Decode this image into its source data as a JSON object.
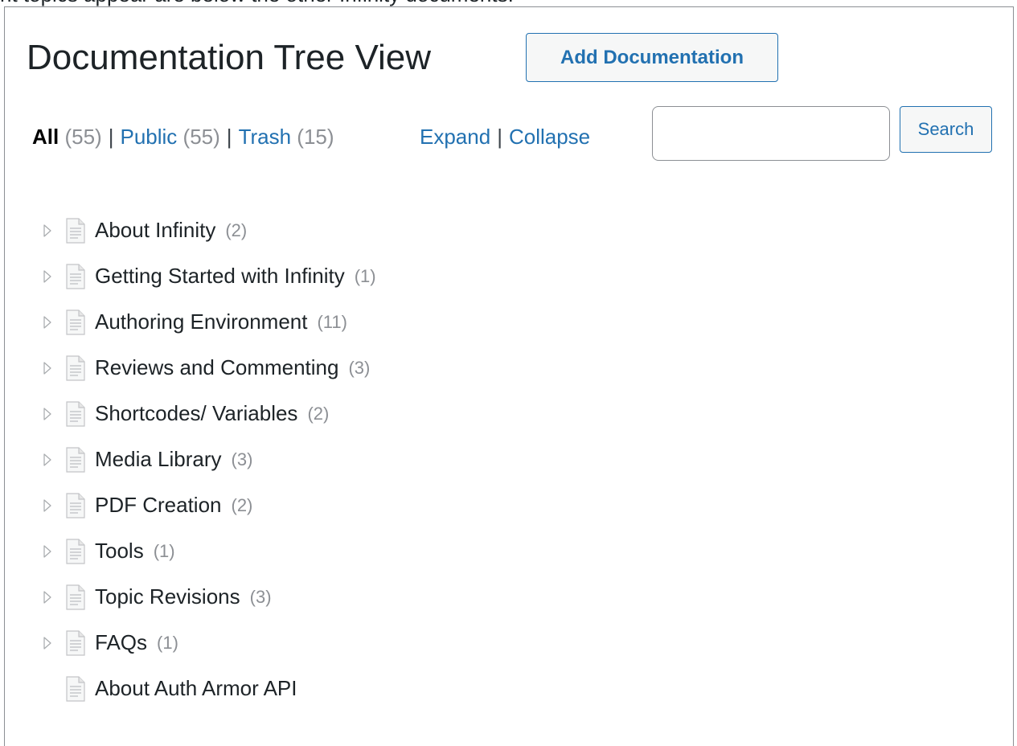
{
  "top_snippet": "nt topics appear are below the other Infinity documents.",
  "header": {
    "title": "Documentation Tree View",
    "add_button_label": "Add Documentation"
  },
  "filters": {
    "all": {
      "label": "All",
      "count": "(55)"
    },
    "public": {
      "label": "Public",
      "count": "(55)"
    },
    "trash": {
      "label": "Trash",
      "count": "(15)"
    },
    "separator": "|"
  },
  "tree_actions": {
    "expand": "Expand",
    "collapse": "Collapse",
    "separator": "|"
  },
  "search": {
    "value": "",
    "button_label": "Search"
  },
  "tree": {
    "items": [
      {
        "title": "About Infinity",
        "count": "(2)",
        "has_children": true
      },
      {
        "title": "Getting Started with Infinity",
        "count": "(1)",
        "has_children": true
      },
      {
        "title": "Authoring Environment",
        "count": "(11)",
        "has_children": true
      },
      {
        "title": "Reviews and Commenting",
        "count": "(3)",
        "has_children": true
      },
      {
        "title": "Shortcodes/ Variables",
        "count": "(2)",
        "has_children": true
      },
      {
        "title": "Media Library",
        "count": "(3)",
        "has_children": true
      },
      {
        "title": "PDF Creation",
        "count": "(2)",
        "has_children": true
      },
      {
        "title": "Tools",
        "count": "(1)",
        "has_children": true
      },
      {
        "title": "Topic Revisions",
        "count": "(3)",
        "has_children": true
      },
      {
        "title": "FAQs",
        "count": "(1)",
        "has_children": true
      },
      {
        "title": "About Auth Armor API",
        "count": "",
        "has_children": false
      }
    ],
    "toggle_icon": "triangle-right-icon",
    "item_icon": "document-icon"
  },
  "colors": {
    "link": "#2271b1",
    "count": "#8c8f94",
    "text": "#1d2327",
    "border": "#8c8f94"
  }
}
